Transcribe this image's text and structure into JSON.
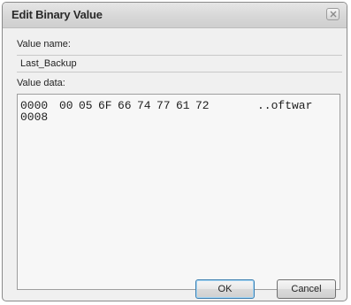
{
  "dialog": {
    "title": "Edit Binary Value",
    "value_name_label": "Value name:",
    "value_name": "Last_Backup",
    "value_data_label": "Value data:",
    "rows": [
      {
        "offset": "0000",
        "bytes": [
          "00",
          "05",
          "6F",
          "66",
          "74",
          "77",
          "61",
          "72"
        ],
        "ascii": "..oftwar"
      },
      {
        "offset": "0008",
        "bytes": [],
        "ascii": ""
      }
    ],
    "ok_label": "OK",
    "cancel_label": "Cancel"
  }
}
